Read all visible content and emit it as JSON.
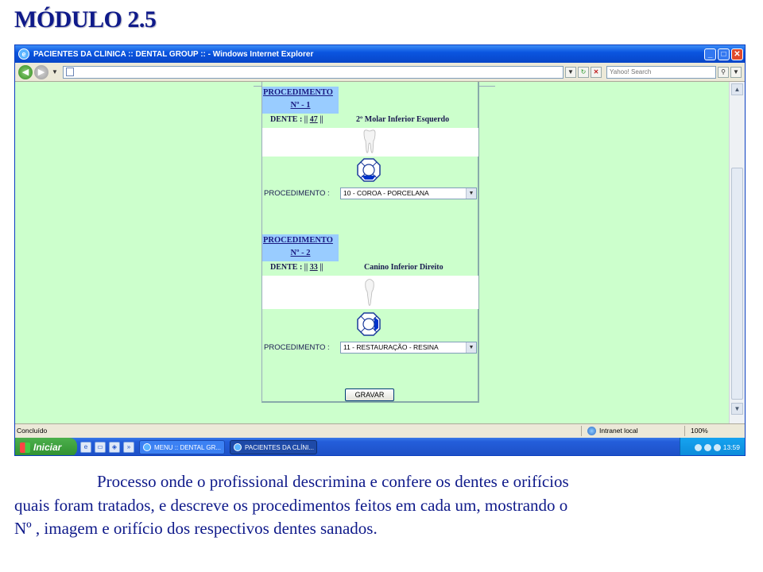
{
  "slide": {
    "title": "MÓDULO 2.5",
    "caption_lines": [
      "Processo onde o profissional descrimina e confere os dentes e orifícios",
      "quais foram tratados, e descreve os procedimentos feitos em cada um, mostrando o",
      "Nº , imagem e orifício dos respectivos dentes sanados."
    ]
  },
  "browser": {
    "window_title": "PACIENTES DA CLÍNICA :: DENTAL GROUP :: - Windows Internet Explorer",
    "search_placeholder": "Yahoo! Search",
    "address": "",
    "status_left": "Concluído",
    "status_zone": "Intranet local",
    "zoom": "100%",
    "colors": {
      "page_bg": "#ccffcc",
      "header_bg": "#99ccff",
      "text_dark": "#1a1a80",
      "orifice_fill": "#0033cc"
    }
  },
  "procedures": [
    {
      "heading": "PROCEDIMENTO",
      "number_label": "Nº - 1",
      "tooth_label": "DENTE :",
      "tooth_number": "47",
      "tooth_name": "2º Molar Inferior Esquerdo",
      "tooth_icon": "molar-tooth-icon",
      "orifice_filled": "bottom",
      "field_label": "PROCEDIMENTO :",
      "selected": "10 - COROA - PORCELANA"
    },
    {
      "heading": "PROCEDIMENTO",
      "number_label": "Nº - 2",
      "tooth_label": "DENTE :",
      "tooth_number": "33",
      "tooth_name": "Canino Inferior Direito",
      "tooth_icon": "canine-tooth-icon",
      "orifice_filled": "right",
      "field_label": "PROCEDIMENTO :",
      "selected": "11 - RESTAURAÇÃO - RESINA"
    }
  ],
  "save_button": "GRAVAR",
  "taskbar": {
    "start_label": "Iniciar",
    "tasks": [
      "MENU :: DENTAL GR...",
      "PACIENTES DA CLÍNI..."
    ],
    "clock": "13:59"
  }
}
